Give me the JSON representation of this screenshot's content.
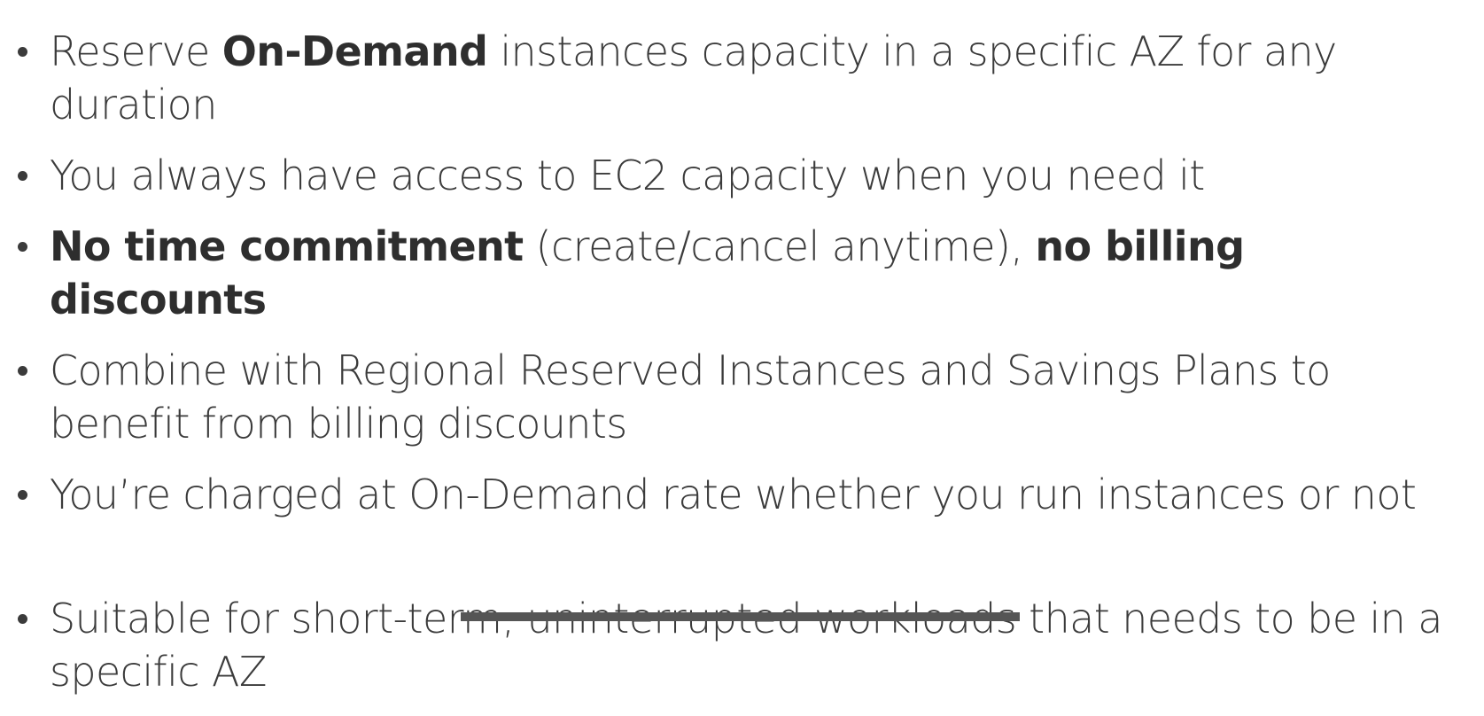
{
  "bullets": [
    {
      "segments": [
        {
          "text": "Reserve ",
          "bold": false
        },
        {
          "text": "On-Demand",
          "bold": true
        },
        {
          "text": " instances capacity in a specific AZ for any duration",
          "bold": false
        }
      ]
    },
    {
      "segments": [
        {
          "text": "You always have access to EC2 capacity when you need it",
          "bold": false
        }
      ]
    },
    {
      "segments": [
        {
          "text": "No time commitment",
          "bold": true
        },
        {
          "text": " (create/cancel anytime), ",
          "bold": false
        },
        {
          "text": "no billing discounts",
          "bold": true
        }
      ]
    },
    {
      "segments": [
        {
          "text": "Combine with Regional Reserved Instances and Savings Plans to benefit from billing discounts",
          "bold": false
        }
      ]
    },
    {
      "segments": [
        {
          "text": "You’re charged at On-Demand rate whether you run instances or not",
          "bold": false
        }
      ]
    },
    {
      "segments": [
        {
          "text": "Suitable for short-term, uninterrupted workloads that needs to be in a specific AZ",
          "bold": false
        }
      ]
    }
  ]
}
